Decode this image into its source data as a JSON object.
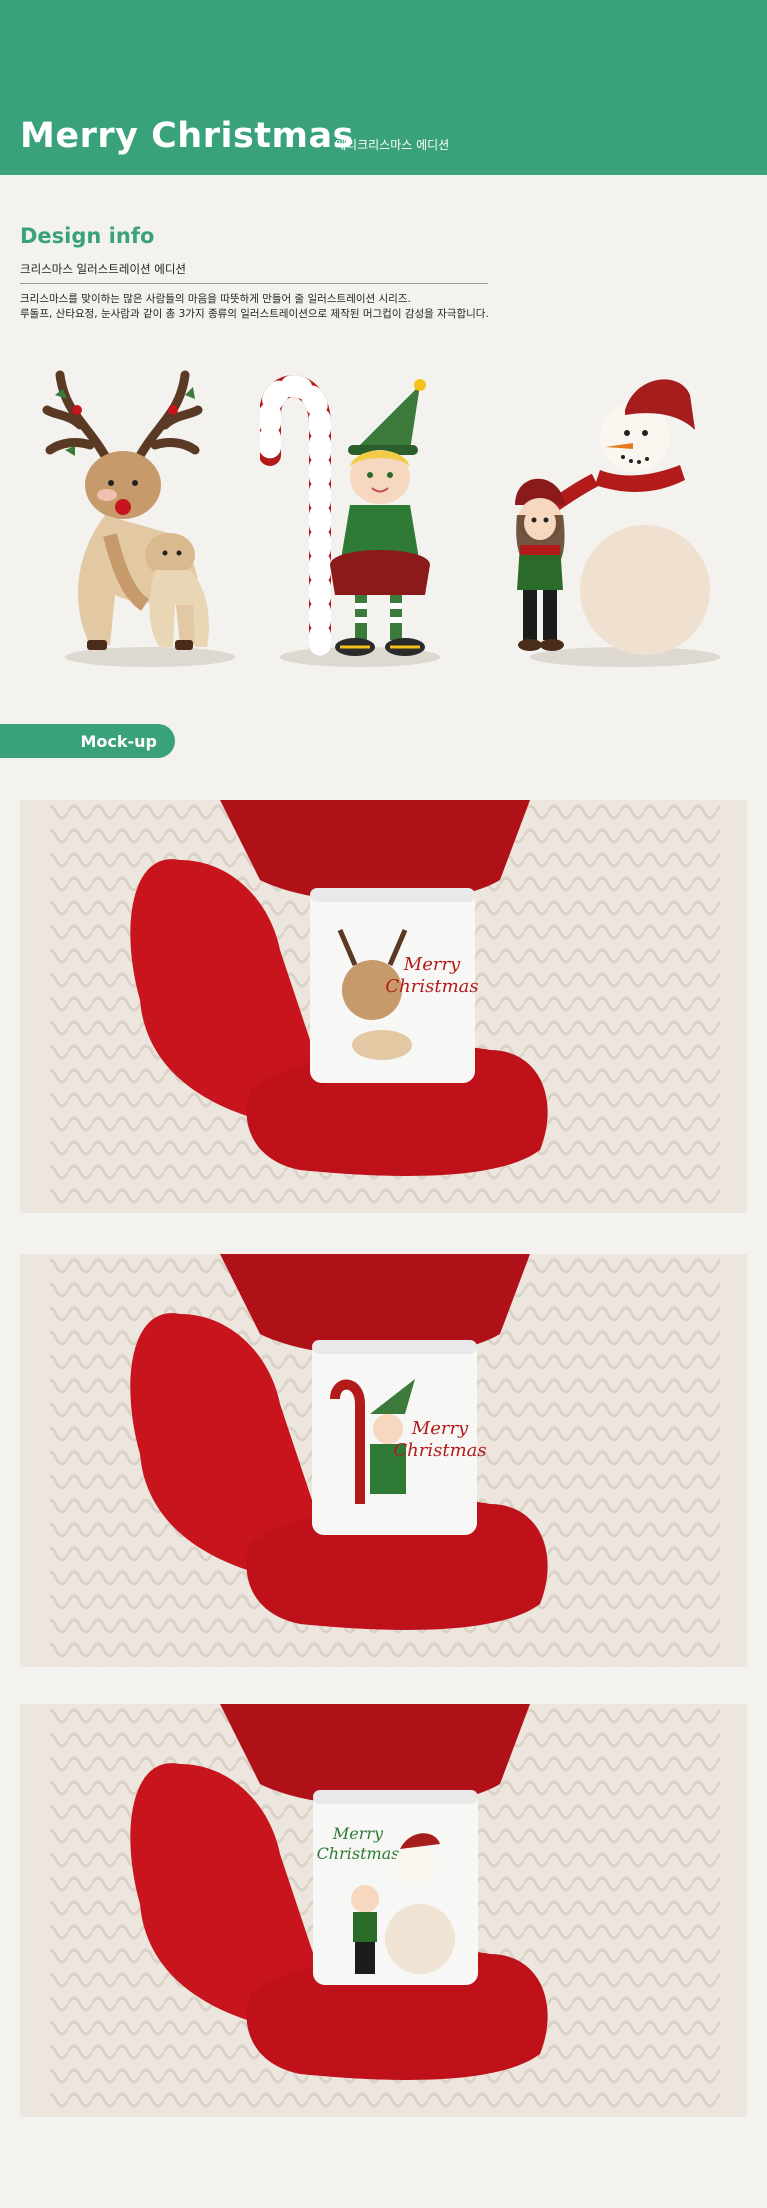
{
  "header": {
    "title": "Merry Christmas",
    "subtitle": "메리크리스마스 에디션"
  },
  "design_info": {
    "heading": "Design info",
    "subheading": "크리스마스 일러스트레이션 에디션",
    "description_line1": "크리스마스를 맞이하는 많은 사람들의 마음을 따뜻하게 만들어 줄 일러스트레이션 시리즈.",
    "description_line2": "루돌프, 산타요정, 눈사람과 같이 총 3가지 종류의 일러스트레이션으로 제작된 머그컵이 감성을 자극합니다."
  },
  "illustrations": [
    {
      "name": "reindeer"
    },
    {
      "name": "elf-with-candy-cane"
    },
    {
      "name": "girl-and-snowman"
    }
  ],
  "mockup": {
    "tab_label": "Mock-up",
    "photos": [
      {
        "design": "reindeer",
        "mug_text_line1": "Merry",
        "mug_text_line2": "Christmas"
      },
      {
        "design": "elf",
        "mug_text_line1": "Merry",
        "mug_text_line2": "Christmas"
      },
      {
        "design": "snowman",
        "mug_text_line1": "Merry",
        "mug_text_line2": "Christmas"
      }
    ]
  },
  "colors": {
    "brand_green": "#3aa27b",
    "mitten_red": "#c8141c",
    "background": "#f3f2ef"
  }
}
